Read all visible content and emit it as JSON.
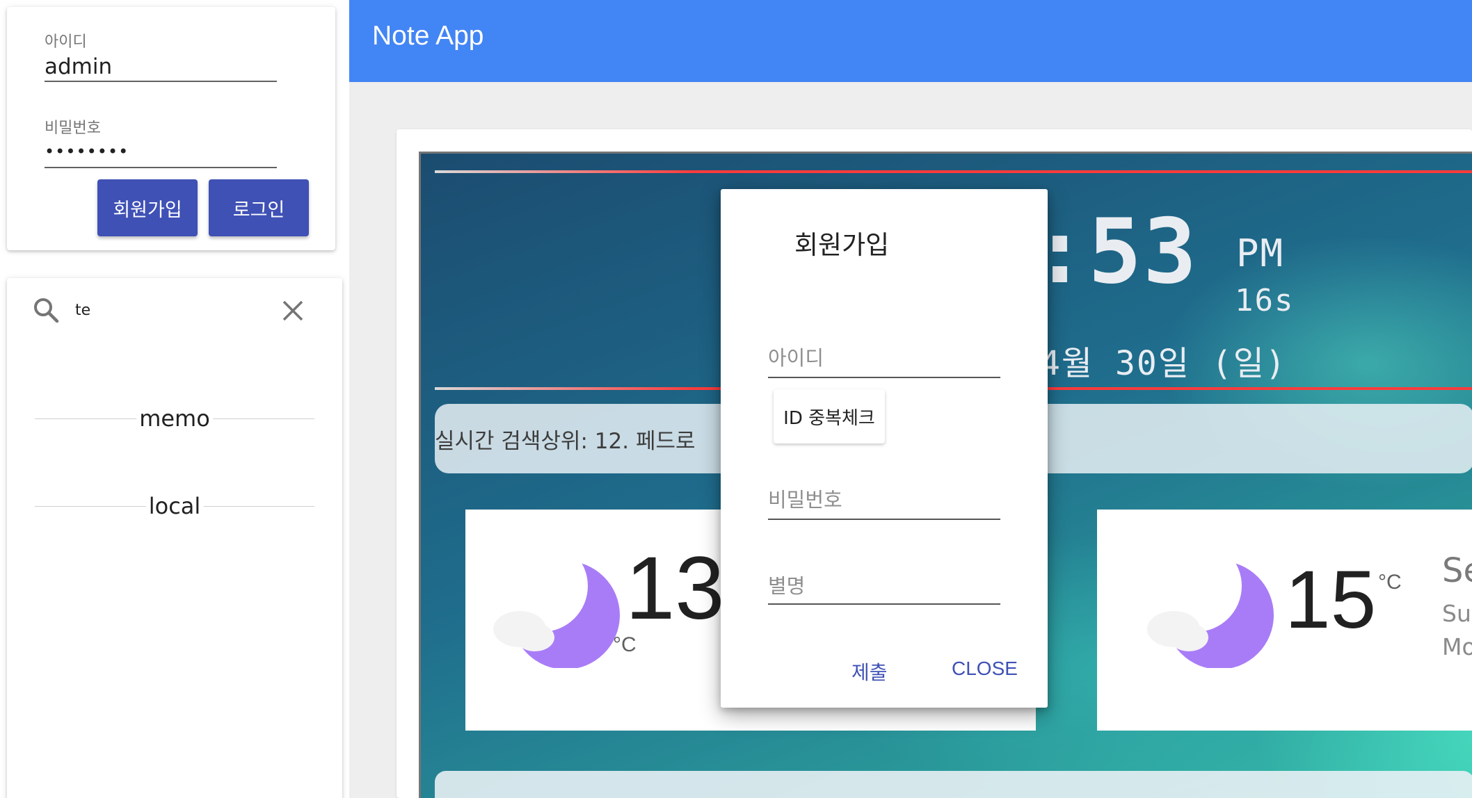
{
  "login": {
    "id_label": "아이디",
    "id_value": "admin",
    "password_label": "비밀번호",
    "password_value": "••••••••",
    "signup_label": "회원가입",
    "login_label": "로그인"
  },
  "search": {
    "query": "te",
    "search_icon": "search-icon",
    "clear_icon": "close-icon",
    "sections": [
      "memo",
      "local"
    ]
  },
  "app": {
    "title": "Note App",
    "color": "#4285f4"
  },
  "clock": {
    "time_partial": ":53",
    "ampm": "PM",
    "seconds": "16s",
    "date_partial": "4월 30일 (일)"
  },
  "ticker": {
    "text": "실시간 검색상위: 12. 페드로"
  },
  "weather": [
    {
      "icon": "moon-cloud-icon",
      "temp": "13",
      "unit": "°C"
    },
    {
      "icon": "moon-cloud-icon",
      "temp": "15",
      "unit": "°C",
      "lines": [
        "Se",
        "Sur",
        "Mo"
      ]
    }
  ],
  "dialog": {
    "title": "회원가입",
    "id_label": "아이디",
    "id_check_label": "ID 중복체크",
    "password_label": "비밀번호",
    "nickname_label": "별명",
    "submit_label": "제출",
    "close_label": "CLOSE"
  },
  "colors": {
    "primary_button": "#3f51b5",
    "moon": "#a97cf7"
  }
}
